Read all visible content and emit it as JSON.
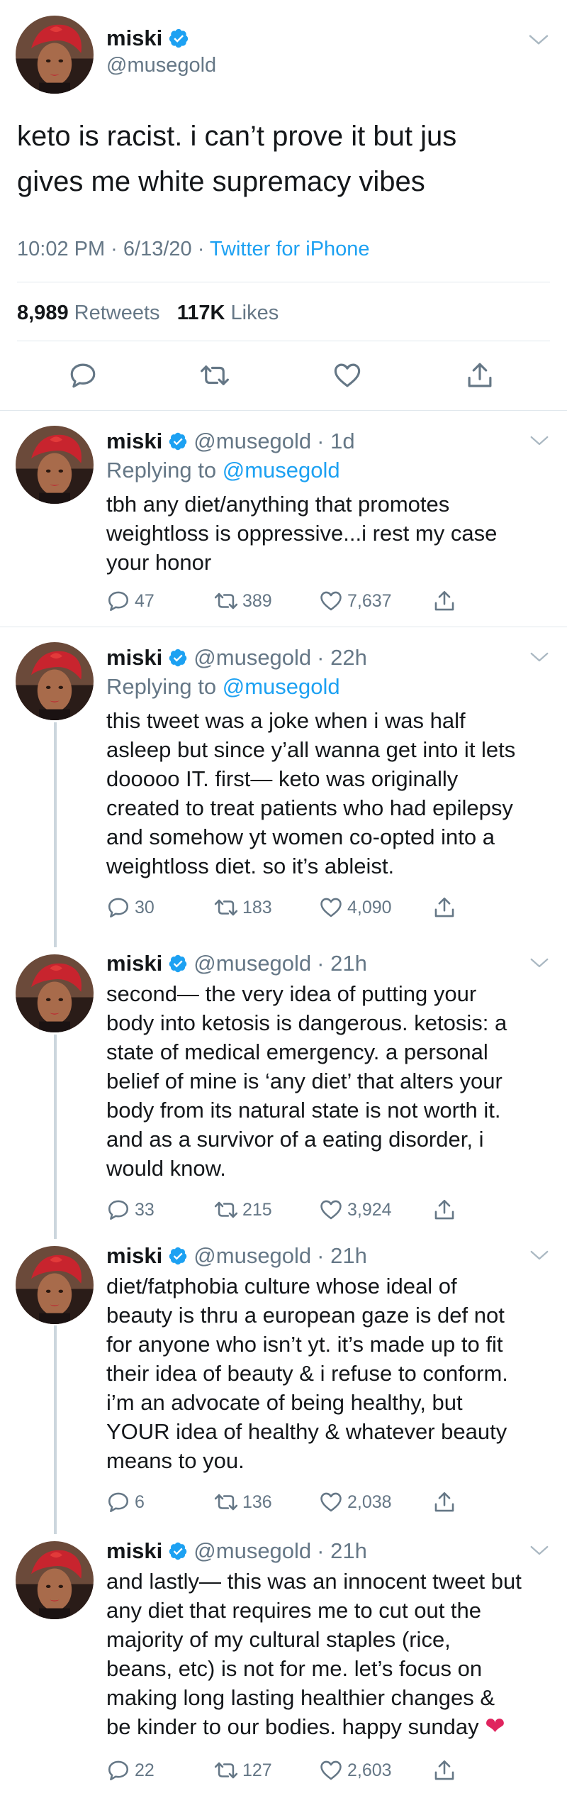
{
  "author": {
    "name": "miski",
    "handle": "@musegold"
  },
  "main_tweet": {
    "text_line1": "keto is racist. i can’t prove it but jus",
    "text_line2": "gives me white supremacy vibes",
    "time": "10:02 PM · 6/13/20 · ",
    "source": "Twitter for iPhone",
    "retweets_count": "8,989",
    "retweets_label": "Retweets",
    "likes_count": "117K",
    "likes_label": "Likes"
  },
  "replies": [
    {
      "name": "miski",
      "handle": "@musegold",
      "time": "· 1d",
      "replying_label": "Replying to ",
      "replying_to": "@musegold",
      "lines": [
        "tbh any diet/anything that promotes",
        "weightloss is oppressive...i rest my case",
        "your honor"
      ],
      "replies": "47",
      "retweets": "389",
      "likes": "7,637"
    },
    {
      "name": "miski",
      "handle": "@musegold",
      "time": "· 22h",
      "replying_label": "Replying to ",
      "replying_to": "@musegold",
      "lines": [
        "this tweet was a joke when i was half",
        "asleep but since y’all wanna get into it lets",
        "dooooo IT. first— keto was originally",
        "created to treat patients who had epilepsy",
        "and somehow yt women co-opted into a",
        "weightloss diet. so it’s ableist."
      ],
      "replies": "30",
      "retweets": "183",
      "likes": "4,090"
    },
    {
      "name": "miski",
      "handle": "@musegold",
      "time": "· 21h",
      "lines": [
        "second— the very idea of putting your",
        "body into ketosis is dangerous. ketosis: a",
        "state of medical emergency. a personal",
        "belief of mine is ‘any diet’ that alters your",
        "body from its natural state is not worth it.",
        "and as a survivor of a eating disorder, i",
        "would know."
      ],
      "replies": "33",
      "retweets": "215",
      "likes": "3,924"
    },
    {
      "name": "miski",
      "handle": "@musegold",
      "time": "· 21h",
      "lines": [
        "diet/fatphobia culture whose ideal of",
        "beauty is thru a european gaze is def not",
        "for anyone who isn’t yt. it’s made up to fit",
        "their idea of beauty & i refuse to conform.",
        "i’m an advocate of being healthy, but",
        "YOUR idea of healthy & whatever beauty",
        "means to you."
      ],
      "replies": "6",
      "retweets": "136",
      "likes": "2,038"
    },
    {
      "name": "miski",
      "handle": "@musegold",
      "time": "· 21h",
      "lines": [
        "and lastly— this was an innocent tweet but",
        "any diet that requires me to cut out the",
        "majority of my cultural staples (rice,",
        "beans, etc) is not for me. let’s focus on",
        "making long lasting healthier changes &",
        "be kinder to our bodies. happy sunday"
      ],
      "emoji": "❤",
      "replies": "22",
      "retweets": "127",
      "likes": "2,603"
    }
  ],
  "icons": {
    "verified": "verified-badge-icon",
    "reply": "reply-icon",
    "retweet": "retweet-icon",
    "like": "heart-icon",
    "share": "share-icon",
    "more": "chevron-down-icon"
  },
  "colors": {
    "accent": "#1da1f2",
    "muted": "#657786",
    "text": "#14171a",
    "divider": "#e1e8ed",
    "heart_emoji": "#e0245e"
  }
}
